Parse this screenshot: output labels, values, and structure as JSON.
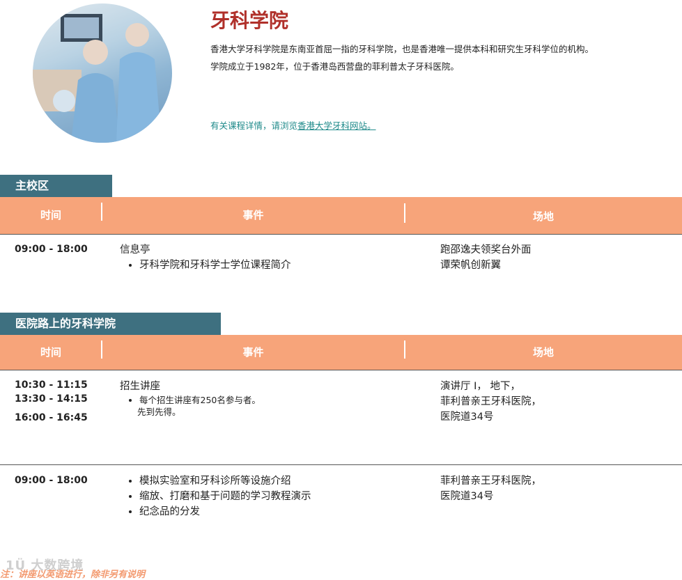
{
  "header": {
    "title": "牙科学院",
    "intro_line1": "香港大学牙科学院是东南亚首屈一指的牙科学院，也是香港唯一提供本科和研究生牙科学位的机构。",
    "intro_line2": "学院成立于1982年，位于香港岛西营盘的菲利普太子牙科医院。",
    "more_prefix": "有关课程详情，请浏览",
    "more_link": "香港大学牙科网站。"
  },
  "columns": {
    "time": "时间",
    "event": "事件",
    "venue": "场地"
  },
  "sections": [
    {
      "name": "主校区",
      "rows": [
        {
          "times": [
            "09:00 - 18:00"
          ],
          "event_title": "信息亭",
          "bullets": [
            "牙科学院和牙科学士学位课程简介"
          ],
          "venue": [
            "跑邵逸夫领奖台外面",
            "谭荣帆创新翼"
          ]
        }
      ]
    },
    {
      "name": "医院路上的牙科学院",
      "rows": [
        {
          "times": [
            "10:30 - 11:15",
            "13:30 - 14:15",
            "16:00 - 16:45"
          ],
          "event_title": "招生讲座",
          "bullets": [
            "每个招生讲座有250名参与者。",
            "先到先得。"
          ],
          "venue": [
            "演讲厅 I， 地下，",
            "菲利普亲王牙科医院，",
            "医院道34号"
          ]
        },
        {
          "times": [
            "09:00 - 18:00"
          ],
          "event_title": "",
          "bullets": [
            "模拟实验室和牙科诊所等设施介绍",
            "缩放、打磨和基于问题的学习教程演示",
            "纪念品的分发"
          ],
          "venue": [
            "菲利普亲王牙科医院，",
            "医院道34号"
          ]
        }
      ]
    }
  ],
  "footer_note": "注：讲座以英语进行，除非另有说明",
  "watermark": "1Ü 大数跨境",
  "colors": {
    "title": "#b0302a",
    "section_tab": "#3e7080",
    "table_header": "#f7a47a",
    "link": "#1f8a8a",
    "note": "#f39a70"
  },
  "icons": {
    "photo": "dental-clinic-photo"
  }
}
